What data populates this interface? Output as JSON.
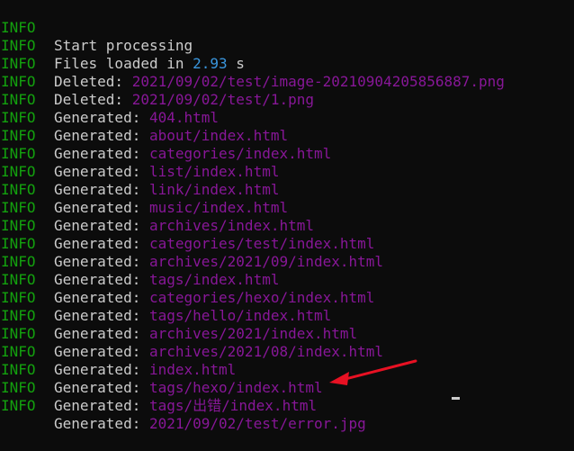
{
  "log": {
    "level": "INFO",
    "lines": [
      {
        "label": "Start processing",
        "value": ""
      },
      {
        "label": "Files loaded in ",
        "num": "2.93",
        "suffix": " s"
      },
      {
        "label": "Deleted: ",
        "value": "2021/09/02/test/image-20210904205856887.png"
      },
      {
        "label": "Deleted: ",
        "value": "2021/09/02/test/1.png"
      },
      {
        "label": "Generated: ",
        "value": "404.html"
      },
      {
        "label": "Generated: ",
        "value": "about/index.html"
      },
      {
        "label": "Generated: ",
        "value": "categories/index.html"
      },
      {
        "label": "Generated: ",
        "value": "list/index.html"
      },
      {
        "label": "Generated: ",
        "value": "link/index.html"
      },
      {
        "label": "Generated: ",
        "value": "music/index.html"
      },
      {
        "label": "Generated: ",
        "value": "archives/index.html"
      },
      {
        "label": "Generated: ",
        "value": "categories/test/index.html"
      },
      {
        "label": "Generated: ",
        "value": "archives/2021/09/index.html"
      },
      {
        "label": "Generated: ",
        "value": "tags/index.html"
      },
      {
        "label": "Generated: ",
        "value": "categories/hexo/index.html"
      },
      {
        "label": "Generated: ",
        "value": "tags/hello/index.html"
      },
      {
        "label": "Generated: ",
        "value": "archives/2021/index.html"
      },
      {
        "label": "Generated: ",
        "value": "archives/2021/08/index.html"
      },
      {
        "label": "Generated: ",
        "value": "index.html"
      },
      {
        "label": "Generated: ",
        "value": "tags/hexo/index.html"
      },
      {
        "label": "Generated: ",
        "value": "tags/出错/index.html"
      },
      {
        "label": "Generated: ",
        "value": "2021/09/02/test/error.jpg"
      }
    ]
  },
  "colors": {
    "background": "#0c0c0c",
    "level": "#13a10e",
    "text": "#cccccc",
    "path": "#881798",
    "number": "#3a96dd",
    "annotation_arrow": "#e81123"
  },
  "icons": {
    "annotation": "red-arrow-icon",
    "cursor": "text-cursor"
  }
}
